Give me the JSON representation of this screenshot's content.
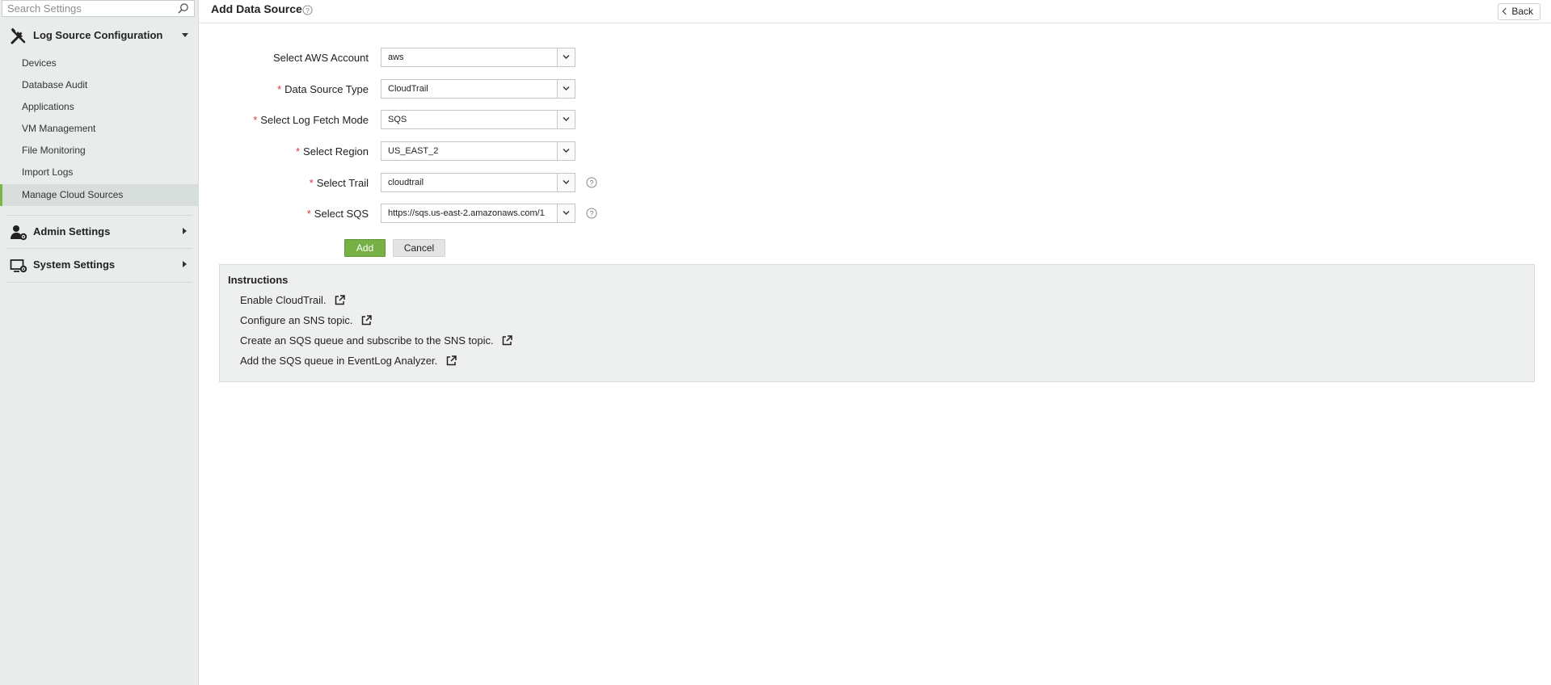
{
  "sidebar": {
    "search_placeholder": "Search Settings",
    "sections": [
      {
        "label": "Log Source Configuration",
        "icon": "tools-icon",
        "expanded": true
      },
      {
        "label": "Admin Settings",
        "icon": "admin-user-gear-icon",
        "expanded": false
      },
      {
        "label": "System Settings",
        "icon": "monitor-gear-icon",
        "expanded": false
      }
    ],
    "items": [
      {
        "label": "Devices"
      },
      {
        "label": "Database Audit"
      },
      {
        "label": "Applications"
      },
      {
        "label": "VM Management"
      },
      {
        "label": "File Monitoring"
      },
      {
        "label": "Import Logs"
      },
      {
        "label": "Manage Cloud Sources",
        "active": true
      }
    ],
    "active_accent": "#7ab648"
  },
  "header": {
    "title": "Add Data Source",
    "back_label": "Back"
  },
  "form": {
    "fields": [
      {
        "label": "Select AWS Account",
        "required": false,
        "value": "aws"
      },
      {
        "label": "Data Source Type",
        "required": true,
        "value": "CloudTrail"
      },
      {
        "label": "Select Log Fetch Mode",
        "required": true,
        "value": "SQS"
      },
      {
        "label": "Select Region",
        "required": true,
        "value": "US_EAST_2"
      },
      {
        "label": "Select Trail",
        "required": true,
        "value": "cloudtrail",
        "help": true
      },
      {
        "label": "Select SQS",
        "required": true,
        "value": "https://sqs.us-east-2.amazonaws.com/1",
        "help": true
      }
    ],
    "required_marker": "*",
    "add_label": "Add",
    "cancel_label": "Cancel",
    "add_color": "#77b045"
  },
  "instructions": {
    "title": "Instructions",
    "items": [
      {
        "text": "Enable CloudTrail."
      },
      {
        "text": "Configure an SNS topic."
      },
      {
        "text": "Create an SQS queue and subscribe to the SNS topic."
      },
      {
        "text": "Add the SQS queue in EventLog Analyzer."
      }
    ]
  }
}
